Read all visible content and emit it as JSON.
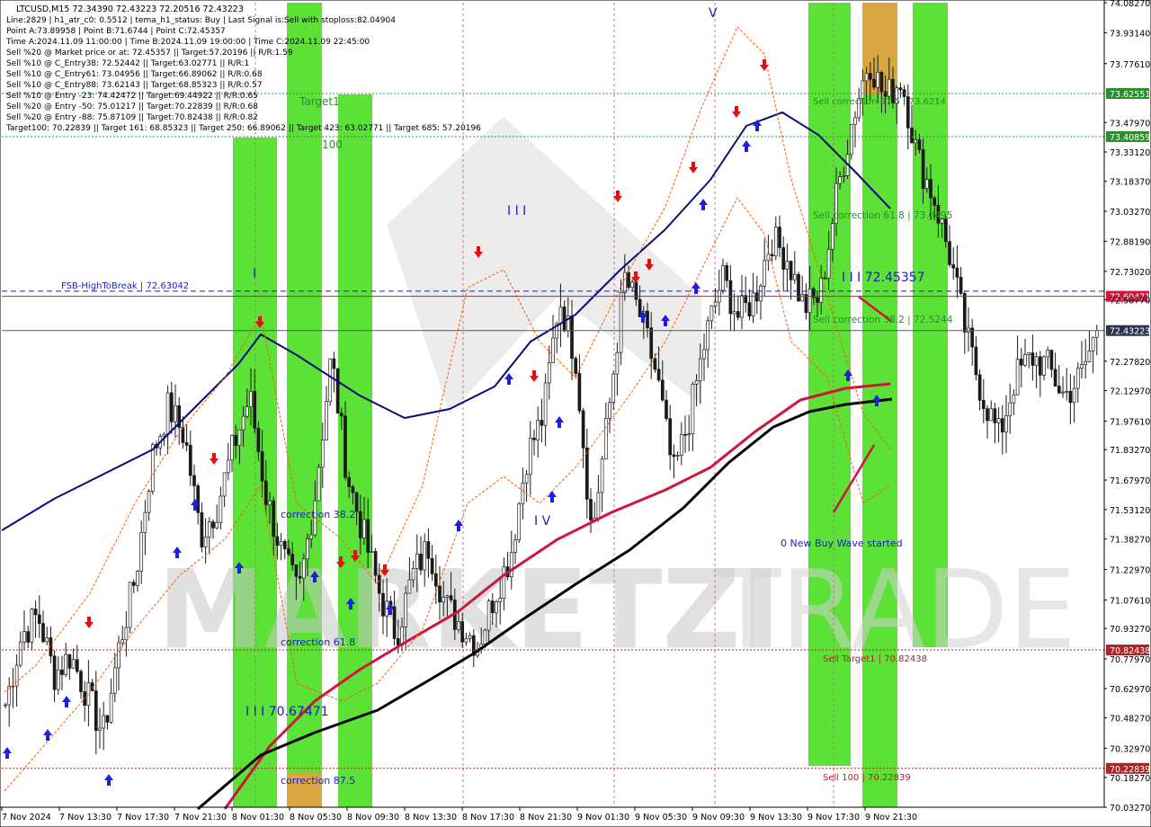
{
  "header": {
    "symbol_line": "LTCUSD,M15  72.34390 72.43223 72.20516 72.43223",
    "info_lines": [
      "Line:2829  |  h1_atr_c0: 0.5512  |  tema_h1_status: Buy  |  Last Signal is:Sell with stoploss:82.04904",
      "Point A:73.89958  |  Point B:71.6744  |  Point C:72.45357",
      "Time A:2024.11.09 11:00:00  |  Time B:2024.11.09 19:00:00  |  Time C:2024.11.09 22:45:00",
      "Sell %20 @ Market price or at: 72.45357  ||  Target:57.20196  ||  R/R:1.59",
      "Sell %10 @ C_Entry38: 72.52442  ||  Target:63.02771  ||  R/R:1",
      "Sell %10 @ C_Entry61: 73.04956  ||  Target:66.89062  ||  R/R:0.68",
      "Sell %10 @ C_Entry88: 73.62143  ||  Target:68.85323  ||  R/R:0.57",
      "Sell %10 @ Entry -23: 74.42472  ||  Target:69.44922  ||  R/R:0.65",
      "Sell %20 @ Entry -50: 75.01217  ||  Target:70.22839  ||  R/R:0.68",
      "Sell %20 @ Entry -88: 75.87109  ||  Target:70.82438  ||  R/R:0.82",
      "Target100: 70.22839  ||  Target 161: 68.85323  ||  Target 250: 66.89062  ||  Target 423: 63.02771  ||  Target 685: 57.20196"
    ]
  },
  "watermark": {
    "text_a": "MARKETZI",
    "text_b": "TRADE"
  },
  "colors": {
    "bull": "#2a2a2a",
    "bear": "#2a2a2a",
    "zone_green": "#3fdc14",
    "zone_orange": "#e6a142",
    "ma_blue": "#0a0a7a",
    "ma_red": "#d0143c",
    "ma_black": "#000000",
    "level_green": "#2e8b2e",
    "level_red": "#b22222",
    "level_blue": "#1c1cc8",
    "stop_orange": "#ff5a00"
  },
  "chart_data": {
    "type": "candlestick",
    "symbol": "LTCUSD",
    "timeframe": "M15",
    "ylim": [
      70.0327,
      74.0827
    ],
    "y_ticks": [
      "74.08270",
      "73.93140",
      "73.77610",
      "73.62551",
      "73.47970",
      "73.40859",
      "73.33120",
      "73.18370",
      "73.03270",
      "72.88190",
      "72.73020",
      "72.60471",
      "72.58770",
      "72.43223",
      "72.27820",
      "72.12970",
      "71.97610",
      "71.83270",
      "71.67970",
      "71.53120",
      "71.38270",
      "71.22970",
      "71.07610",
      "70.93270",
      "70.82438",
      "70.77970",
      "70.62970",
      "70.48270",
      "70.32970",
      "70.22839",
      "70.18270",
      "70.03270"
    ],
    "x_ticks": [
      "7 Nov 2024",
      "7 Nov 13:30",
      "7 Nov 17:30",
      "7 Nov 21:30",
      "8 Nov 01:30",
      "8 Nov 05:30",
      "8 Nov 09:30",
      "8 Nov 13:30",
      "8 Nov 17:30",
      "8 Nov 21:30",
      "9 Nov 01:30",
      "9 Nov 05:30",
      "9 Nov 09:30",
      "9 Nov 13:30",
      "9 Nov 17:30",
      "9 Nov 21:30"
    ],
    "close_path": [
      70.55,
      70.9,
      71.0,
      70.7,
      70.8,
      70.6,
      70.4,
      70.85,
      71.2,
      71.8,
      72.05,
      71.9,
      71.4,
      71.55,
      71.85,
      72.1,
      71.6,
      71.3,
      71.1,
      71.6,
      72.3,
      71.7,
      71.4,
      71.1,
      70.9,
      71.2,
      71.35,
      71.05,
      70.95,
      70.85,
      71.1,
      71.3,
      71.8,
      72.0,
      72.6,
      72.3,
      71.4,
      72.0,
      72.7,
      72.5,
      72.2,
      71.7,
      72.0,
      72.4,
      72.7,
      72.5,
      72.6,
      72.9,
      72.8,
      72.55,
      72.6,
      73.1,
      73.5,
      73.8,
      73.6,
      73.7,
      73.3,
      73.1,
      72.8,
      72.4,
      72.1,
      71.9,
      72.2,
      72.3,
      72.25,
      72.1,
      72.2,
      72.43223
    ],
    "last_price": 72.43223,
    "levels": [
      {
        "price": 73.62551,
        "label": "Sell correction 87.5 | 73.6214",
        "tag": "73.62551",
        "color": "#2e8b2e",
        "style": "dotted"
      },
      {
        "price": 73.40859,
        "label": "",
        "tag": "73.40859",
        "color": "#2e8b2e",
        "style": "dotted"
      },
      {
        "price": 72.63042,
        "label": "FSB-HighToBreak  |  72.63042",
        "tag": "72.63042",
        "color": "#1c1cc8",
        "style": "dashed"
      },
      {
        "price": 72.60471,
        "label": "",
        "tag": "72.60471",
        "color": "#d0143c",
        "style": "solid"
      },
      {
        "price": 72.43223,
        "label": "",
        "tag": "72.43223",
        "color": "#4a5a7a",
        "style": "solid"
      },
      {
        "price": 70.82438,
        "label": "Sell Target1 | 70.82438",
        "tag": "70.82438",
        "color": "#b22222",
        "style": "dotted"
      },
      {
        "price": 70.22839,
        "label": "Sell 100 | 70.22839",
        "tag": "70.22839",
        "color": "#b22222",
        "style": "dotted"
      }
    ],
    "annotations": [
      "Target1",
      "100",
      "correction 38.2",
      "correction 61.8",
      "correction 87.5",
      "I I I 70.67471",
      "I I I 72.45357",
      "Sell correction 61.8 | 73.0495",
      "Sell correction 38.2 | 72.5244",
      "0 New Buy Wave started",
      "I",
      "I I I",
      "I V",
      "V"
    ]
  }
}
